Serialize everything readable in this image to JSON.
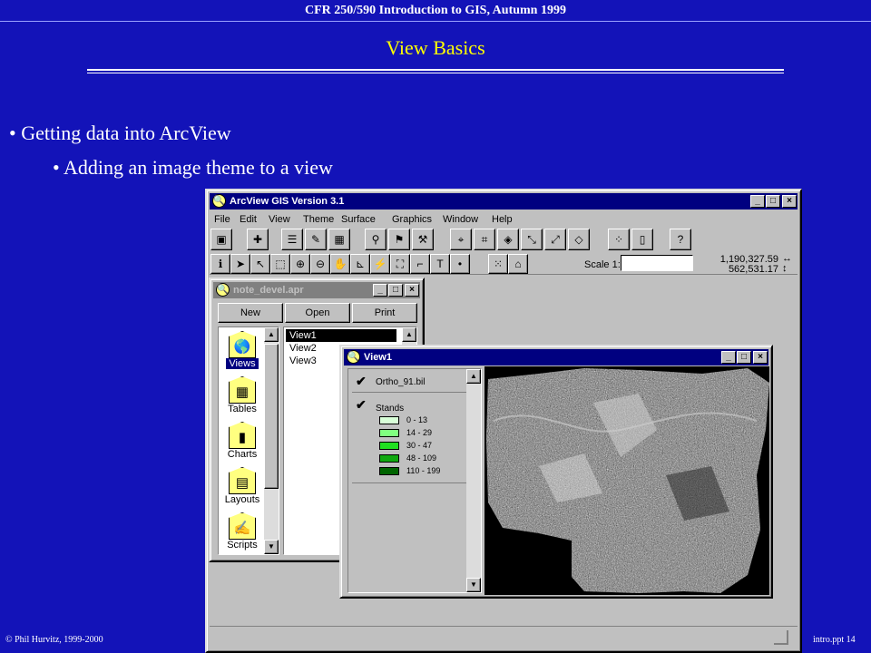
{
  "slide": {
    "header": "CFR 250/590 Introduction to GIS, Autumn 1999",
    "title": "View Basics",
    "bullets": [
      "Getting data into ArcView",
      "Adding an image theme to a view"
    ],
    "footer_left": "© Phil Hurvitz, 1999-2000",
    "footer_right": "intro.ppt 14"
  },
  "arcview": {
    "title": "ArcView GIS Version 3.1",
    "menu": [
      "File",
      "Edit",
      "View",
      "Theme",
      "Surface",
      "Graphics",
      "Window",
      "Help"
    ],
    "scale_label": "Scale 1:",
    "scale_value": "",
    "coord_x": "1,190,327.59",
    "coord_y": "562,531.17"
  },
  "project": {
    "title": "note_devel.apr",
    "buttons": [
      "New",
      "Open",
      "Print"
    ],
    "doc_types": [
      "Views",
      "Tables",
      "Charts",
      "Layouts",
      "Scripts"
    ],
    "views_list": [
      "View1",
      "View2",
      "View3"
    ]
  },
  "view1": {
    "title": "View1",
    "themes": [
      {
        "name": "Ortho_91.bil",
        "checked": true
      },
      {
        "name": "Stands",
        "checked": true
      }
    ],
    "legend": [
      {
        "label": "0 - 13",
        "color": "#d8ffd8"
      },
      {
        "label": "14 - 29",
        "color": "#80ff80"
      },
      {
        "label": "30 - 47",
        "color": "#20e020"
      },
      {
        "label": "48 - 109",
        "color": "#10a810"
      },
      {
        "label": "110 - 199",
        "color": "#006400"
      }
    ]
  }
}
